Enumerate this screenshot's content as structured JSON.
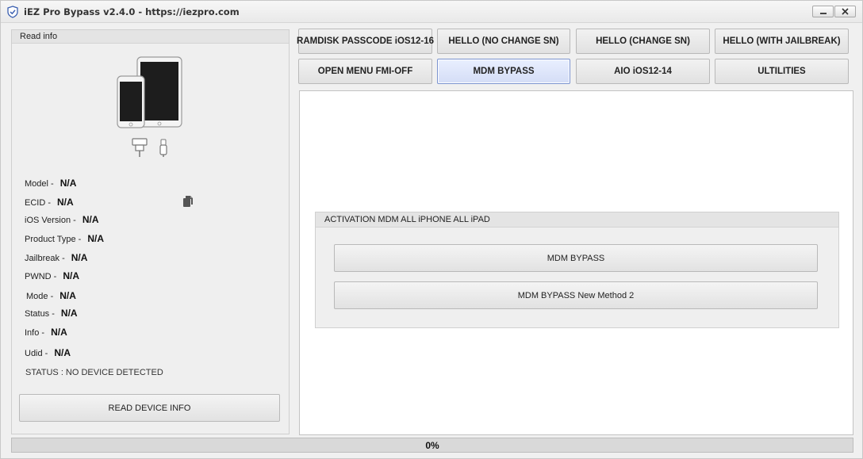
{
  "window": {
    "title": "iEZ Pro Bypass v2.4.0 - https://iezpro.com",
    "icon": "shield-icon",
    "controls": {
      "minimize_icon": "minimize-icon",
      "close_icon": "close-icon"
    }
  },
  "left_panel": {
    "header": "Read info",
    "device_icons": [
      "ipad-icon",
      "iphone-icon",
      "dock-connector-icon",
      "lightning-cable-icon"
    ],
    "fields": [
      {
        "label": "Model -",
        "value": "N/A"
      },
      {
        "label": "ECID -",
        "value": "N/A"
      },
      {
        "label": "iOS Version -",
        "value": "N/A"
      },
      {
        "label": "Product Type -",
        "value": "N/A"
      },
      {
        "label": "Jailbreak -",
        "value": "N/A"
      },
      {
        "label": "PWND -",
        "value": "N/A"
      },
      {
        "label": "Mode -",
        "value": "N/A"
      },
      {
        "label": "Status -",
        "value": "N/A"
      },
      {
        "label": "Info -",
        "value": "N/A"
      },
      {
        "label": "Udid -",
        "value": "N/A"
      }
    ],
    "copy_icon": "copy-icon",
    "status_text": "STATUS : NO DEVICE DETECTED",
    "read_button": "READ DEVICE INFO"
  },
  "tabs": [
    {
      "label": "RAMDISK PASSCODE iOS12-16",
      "active": false
    },
    {
      "label": "HELLO (NO CHANGE SN)",
      "active": false
    },
    {
      "label": "HELLO (CHANGE SN)",
      "active": false
    },
    {
      "label": "HELLO (WITH JAILBREAK)",
      "active": false
    },
    {
      "label": "OPEN MENU FMI-OFF",
      "active": false
    },
    {
      "label": "MDM BYPASS",
      "active": true
    },
    {
      "label": "AIO iOS12-14",
      "active": false
    },
    {
      "label": "ULTILITIES",
      "active": false
    }
  ],
  "main": {
    "group_title": "ACTIVATION MDM ALL iPHONE ALL iPAD",
    "buttons": [
      {
        "label": "MDM BYPASS"
      },
      {
        "label": "MDM BYPASS New Method 2"
      }
    ]
  },
  "progress": {
    "value": 0,
    "label": "0%"
  },
  "colors": {
    "active_tab_border": "#7a93d0",
    "active_tab_bg": "#dde5fa",
    "progress_fill": "#6cc24a",
    "window_bg": "#f0f0f0"
  }
}
